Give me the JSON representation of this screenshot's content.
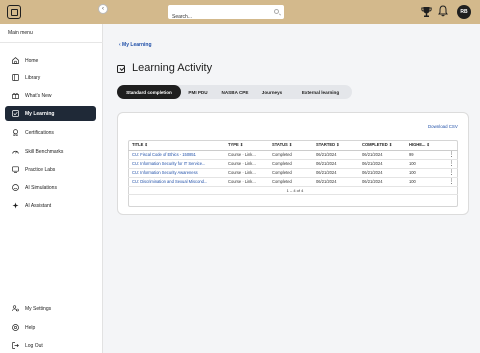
{
  "header": {
    "search_placeholder": "Search...",
    "avatar_initials": "RB"
  },
  "sidebar": {
    "heading": "Main menu",
    "collapse": "‹",
    "items": [
      {
        "label": "Home",
        "icon": "home-icon"
      },
      {
        "label": "Library",
        "icon": "library-icon"
      },
      {
        "label": "What's New",
        "icon": "gift-icon"
      },
      {
        "label": "My Learning",
        "icon": "learning-icon",
        "active": true
      },
      {
        "label": "Certifications",
        "icon": "certificate-icon"
      },
      {
        "label": "Skill Benchmarks",
        "icon": "gauge-icon"
      },
      {
        "label": "Practice Labs",
        "icon": "lab-icon"
      },
      {
        "label": "AI Simulations",
        "icon": "ai-simulation-icon"
      },
      {
        "label": "AI Assistant",
        "icon": "sparkle-icon"
      }
    ],
    "bottom_items": [
      {
        "label": "My Settings",
        "icon": "settings-icon"
      },
      {
        "label": "Help",
        "icon": "help-icon"
      },
      {
        "label": "Log Out",
        "icon": "logout-icon"
      }
    ]
  },
  "main": {
    "breadcrumb": "‹ My Learning",
    "page_title": "Learning Activity",
    "tabs": [
      {
        "label": "Standard completion",
        "active": true
      },
      {
        "label": "PMI PDU"
      },
      {
        "label": "NASBA CPE"
      },
      {
        "label": "Journeys"
      },
      {
        "label": "External learning"
      }
    ],
    "download_label": "Download CSV",
    "table": {
      "columns": [
        "TITLE ⇕",
        "TYPE ⇕",
        "STATUS ⇕",
        "STARTED ⇕",
        "COMPLETED ⇕",
        "HIGHE... ⇕",
        ""
      ],
      "rows": [
        [
          "CU: Fiscal Code of Ethics - 150851",
          "Course · Link...",
          "Completed",
          "06/21/2024",
          "06/21/2024",
          "99"
        ],
        [
          "CU: Information Security for IT Service...",
          "Course · Link...",
          "Completed",
          "06/21/2024",
          "06/21/2024",
          "100"
        ],
        [
          "CU: Information Security Awareness",
          "Course · Link...",
          "Completed",
          "06/21/2024",
          "06/21/2024",
          "100"
        ],
        [
          "CU: Discrimination and Sexual Miscond...",
          "Course · Link...",
          "Completed",
          "06/21/2024",
          "06/21/2024",
          "100"
        ]
      ],
      "row_menu": "⋮",
      "pagination": "1 – 4 of 4"
    }
  },
  "colors": {
    "topbar": "#d3b98c",
    "active_nav": "#1f2937",
    "link": "#1f4fa8"
  }
}
